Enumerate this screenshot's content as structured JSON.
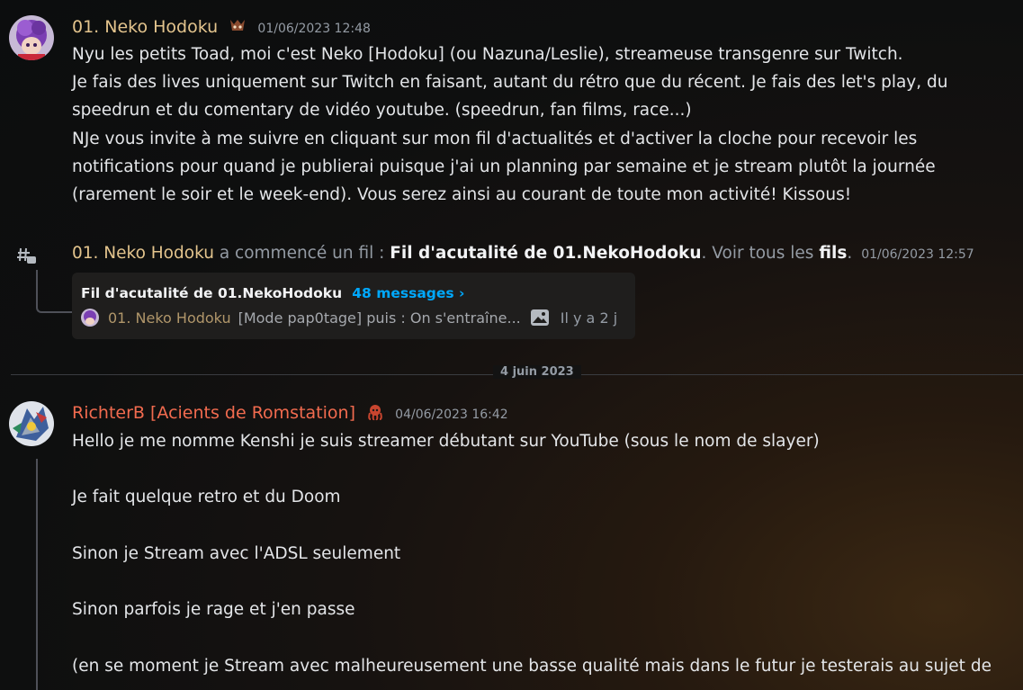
{
  "message1": {
    "author": "01. Neko Hodoku",
    "timestamp": "01/06/2023 12:48",
    "lines": [
      "Nyu les petits Toad, moi c'est Neko [Hodoku] (ou Nazuna/Leslie), streameuse transgenre sur Twitch.",
      "Je fais des lives uniquement sur Twitch en faisant, autant du rétro que du récent. Je fais des let's play, du",
      "speedrun et du comentary de vidéo youtube. (speedrun, fan films, race...)",
      "NJe vous invite à me suivre en cliquant sur mon fil d'actualités et d'activer la cloche pour recevoir les",
      "notifications pour quand je publierai puisque j'ai un planning par semaine et je stream plutôt la journée",
      "(rarement le soir et le week-end). Vous serez ainsi au courant de toute mon activité! Kissous!"
    ]
  },
  "thread_notice": {
    "author": "01. Neko Hodoku",
    "action": " a commencé un fil : ",
    "thread_name": "Fil d'acutalité de 01.NekoHodoku",
    "see_all_prefix": ". Voir tous les ",
    "see_all_link": "fils",
    "see_all_suffix": ".",
    "timestamp": "01/06/2023 12:57"
  },
  "thread_card": {
    "title": "Fil d'acutalité de 01.NekoHodoku",
    "count": "48 messages ›",
    "last_author": "01. Neko Hodoku",
    "last_message": "[Mode pap0tage] puis : On s'entraîne...",
    "time_ago": "Il y a 2 j"
  },
  "date_divider": "4 juin 2023",
  "message2": {
    "author": "RichterB [Acients de Romstation]",
    "timestamp": "04/06/2023 16:42",
    "lines": [
      "Hello je me nomme Kenshi je suis streamer débutant sur YouTube (sous le nom de slayer)",
      "",
      "Je fait quelque retro et du Doom",
      "",
      "Sinon je Stream avec l'ADSL seulement",
      "",
      "Sinon parfois je rage et j'en passe",
      "",
      "(en se moment je Stream avec malheureusement une basse qualité mais dans le futur je testerais au sujet de"
    ]
  }
}
